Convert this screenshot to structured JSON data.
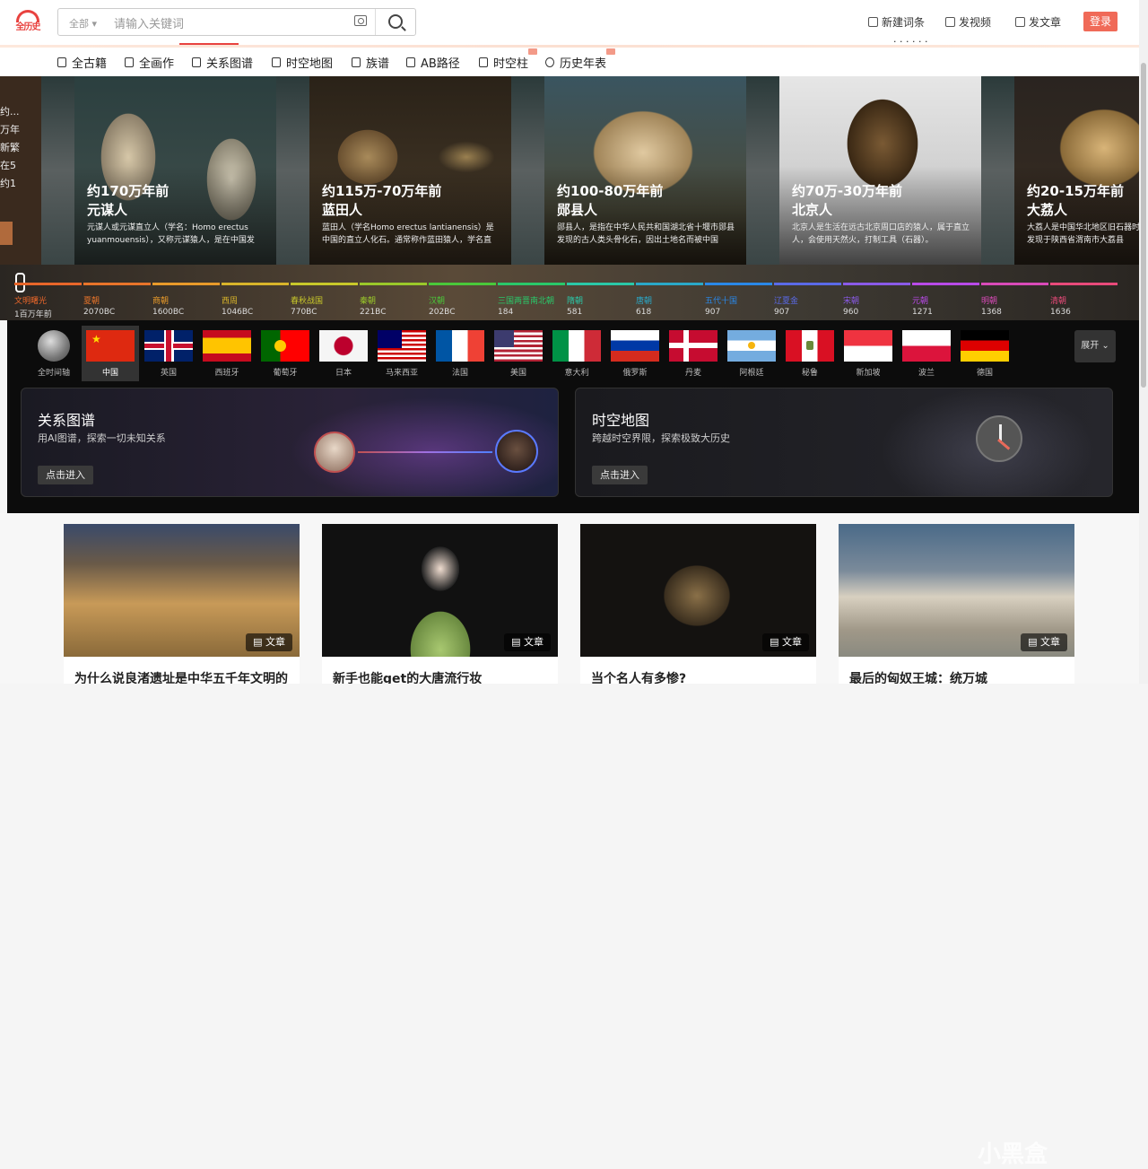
{
  "header": {
    "logo_text": "全历史",
    "search_scope": "全部",
    "search_placeholder": "请输入关键词",
    "actions": [
      "新建词条",
      "发视频",
      "发文章"
    ],
    "login_label": "登录",
    "stray_text": "· · · · · ·"
  },
  "nav": {
    "items": [
      "全古籍",
      "全画作",
      "关系图谱",
      "时空地图",
      "族谱",
      "AB路径",
      "时空柱",
      "历史年表"
    ],
    "new_badges": [
      "时空柱",
      "历史年表"
    ]
  },
  "hero": {
    "left_partial": [
      "约...",
      "万年",
      "新繁",
      "在5",
      "约1"
    ],
    "cards": [
      {
        "era": "约170万年前",
        "name": "元谋人",
        "desc": "元谋人或元谋直立人（学名：Homo erectus yuanmouensis），又称元谋猿人，是在中国发"
      },
      {
        "era": "约115万-70万年前",
        "name": "蓝田人",
        "desc": "蓝田人（学名Homo erectus lantianensis）是中国的直立人化石。通常称作蓝田猿人，学名直"
      },
      {
        "era": "约100-80万年前",
        "name": "郧县人",
        "desc": "郧县人，是指在中华人民共和国湖北省十堰市郧县发现的古人类头骨化石，因出土地名而被中国"
      },
      {
        "era": "约70万-30万年前",
        "name": "北京人",
        "desc": "北京人是生活在远古北京周口店的猿人，属于直立人，会使用天然火，打制工具（石器）。"
      },
      {
        "era": "约20-15万年前",
        "name": "大荔人",
        "desc": "大荔人是中国华北地区旧石器时代中期古人类化石发现于陕西省渭南市大荔县"
      }
    ]
  },
  "timeline": [
    {
      "name": "文明曙光",
      "year": "1百万年前",
      "color": "#e8662a"
    },
    {
      "name": "夏朝",
      "year": "2070BC",
      "color": "#e8742a"
    },
    {
      "name": "商朝",
      "year": "1600BC",
      "color": "#e89a2a"
    },
    {
      "name": "西周",
      "year": "1046BC",
      "color": "#d8b42a"
    },
    {
      "name": "春秋战国",
      "year": "770BC",
      "color": "#c8c82a"
    },
    {
      "name": "秦朝",
      "year": "221BC",
      "color": "#9ac82a"
    },
    {
      "name": "汉朝",
      "year": "202BC",
      "color": "#4ac83a"
    },
    {
      "name": "三国两晋南北朝",
      "year": "184",
      "color": "#2ac86a"
    },
    {
      "name": "隋朝",
      "year": "581",
      "color": "#2ac8a8"
    },
    {
      "name": "唐朝",
      "year": "618",
      "color": "#2aa8c8"
    },
    {
      "name": "五代十国",
      "year": "907",
      "color": "#2a88e8"
    },
    {
      "name": "辽夏金",
      "year": "907",
      "color": "#5a6ae8"
    },
    {
      "name": "宋朝",
      "year": "960",
      "color": "#8a5ae8"
    },
    {
      "name": "元朝",
      "year": "1271",
      "color": "#b84ae8"
    },
    {
      "name": "明朝",
      "year": "1368",
      "color": "#d84ab8"
    },
    {
      "name": "清朝",
      "year": "1636",
      "color": "#e84a7a"
    }
  ],
  "countries": {
    "all_label": "全时间轴",
    "items": [
      "中国",
      "英国",
      "西班牙",
      "葡萄牙",
      "日本",
      "马来西亚",
      "法国",
      "美国",
      "意大利",
      "俄罗斯",
      "丹麦",
      "阿根廷",
      "秘鲁",
      "新加坡",
      "波兰",
      "德国"
    ],
    "selected": "中国",
    "expand_label": "展开 ⌄"
  },
  "features": [
    {
      "title": "关系图谱",
      "subtitle": "用AI图谱，探索一切未知关系",
      "button": "点击进入"
    },
    {
      "title": "时空地图",
      "subtitle": "跨越时空界限，探索极致大历史",
      "button": "点击进入"
    }
  ],
  "articles": [
    {
      "title": "为什么说良渚遗址是中华五千年文明的",
      "tag": "文章"
    },
    {
      "title": "新手也能get的大唐流行妆",
      "tag": "文章"
    },
    {
      "title": "当个名人有多惨?",
      "tag": "文章"
    },
    {
      "title": "最后的匈奴王城：统万城",
      "tag": "文章"
    }
  ],
  "watermark": "小黑盒"
}
